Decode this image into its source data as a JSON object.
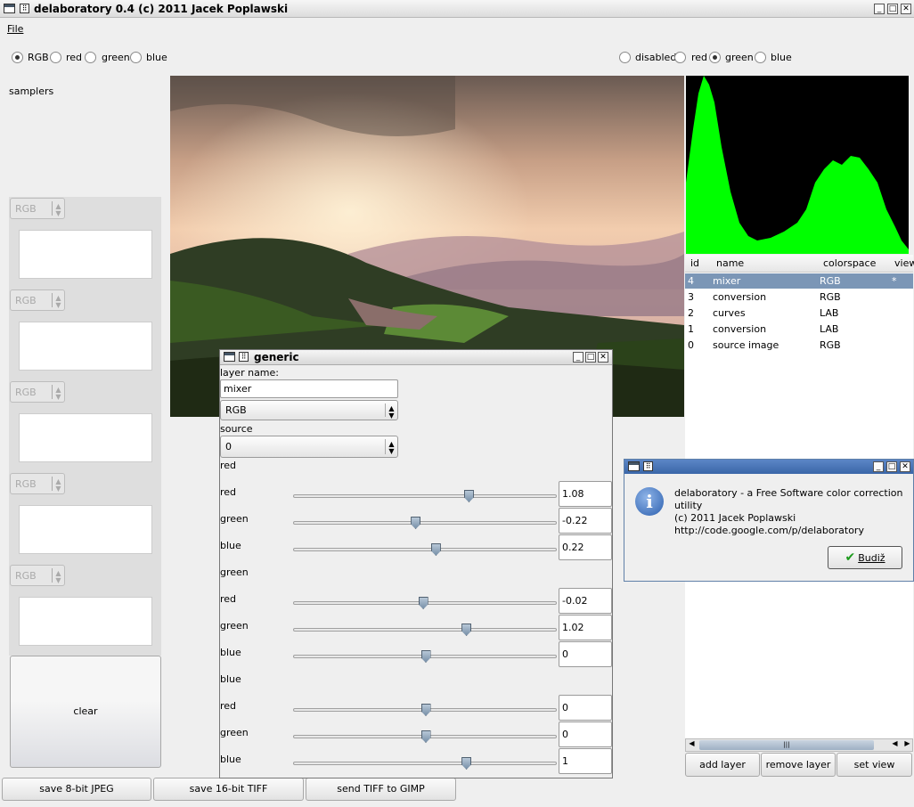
{
  "window": {
    "title": "delaboratory 0.4 (c) 2011 Jacek Poplawski"
  },
  "menu": {
    "file": "File"
  },
  "view_mode": {
    "options": [
      "RGB",
      "red",
      "green",
      "blue"
    ],
    "selected": "RGB"
  },
  "histogram_mode": {
    "options": [
      "disabled",
      "red",
      "green",
      "blue"
    ],
    "selected": "green"
  },
  "samplers": {
    "label": "samplers",
    "items": [
      {
        "colorspace": "RGB"
      },
      {
        "colorspace": "RGB"
      },
      {
        "colorspace": "RGB"
      },
      {
        "colorspace": "RGB"
      },
      {
        "colorspace": "RGB"
      }
    ],
    "clear": "clear"
  },
  "bottom_buttons": {
    "save_jpeg": "save 8-bit JPEG",
    "save_tiff": "save 16-bit TIFF",
    "send_gimp": "send TIFF to GIMP"
  },
  "layers": {
    "columns": [
      "id",
      "name",
      "colorspace",
      "view"
    ],
    "rows": [
      {
        "id": "4",
        "name": "mixer",
        "colorspace": "RGB",
        "view": "*"
      },
      {
        "id": "3",
        "name": "conversion",
        "colorspace": "RGB",
        "view": ""
      },
      {
        "id": "2",
        "name": "curves",
        "colorspace": "LAB",
        "view": ""
      },
      {
        "id": "1",
        "name": "conversion",
        "colorspace": "LAB",
        "view": ""
      },
      {
        "id": "0",
        "name": "source image",
        "colorspace": "RGB",
        "view": ""
      }
    ],
    "selected_index": 0,
    "buttons": {
      "add": "add layer",
      "remove": "remove layer",
      "view": "set view"
    },
    "scroll_grip": "|||"
  },
  "generic": {
    "title": "generic",
    "layer_name_label": "layer name:",
    "layer_name_value": "mixer",
    "colorspace": "RGB",
    "source_label": "source",
    "source_value": "0",
    "groups": [
      {
        "name": "red",
        "channels": [
          {
            "label": "red",
            "value": "1.08",
            "pos": 0.67
          },
          {
            "label": "green",
            "value": "-0.22",
            "pos": 0.46
          },
          {
            "label": "blue",
            "value": "0.22",
            "pos": 0.54
          }
        ]
      },
      {
        "name": "green",
        "channels": [
          {
            "label": "red",
            "value": "-0.02",
            "pos": 0.49
          },
          {
            "label": "green",
            "value": "1.02",
            "pos": 0.66
          },
          {
            "label": "blue",
            "value": "0",
            "pos": 0.5
          }
        ]
      },
      {
        "name": "blue",
        "channels": [
          {
            "label": "red",
            "value": "0",
            "pos": 0.5
          },
          {
            "label": "green",
            "value": "0",
            "pos": 0.5
          },
          {
            "label": "blue",
            "value": "1",
            "pos": 0.66
          }
        ]
      }
    ]
  },
  "about": {
    "line1": "delaboratory - a Free Software color correction utility",
    "line2": "(c) 2011 Jacek Poplawski",
    "line3": "http://code.google.com/p/delaboratory",
    "ok": "Budiž"
  },
  "colors": {
    "histogram": "#00ff00",
    "histogram_bg": "#000000",
    "selection": "#7b96b6"
  }
}
